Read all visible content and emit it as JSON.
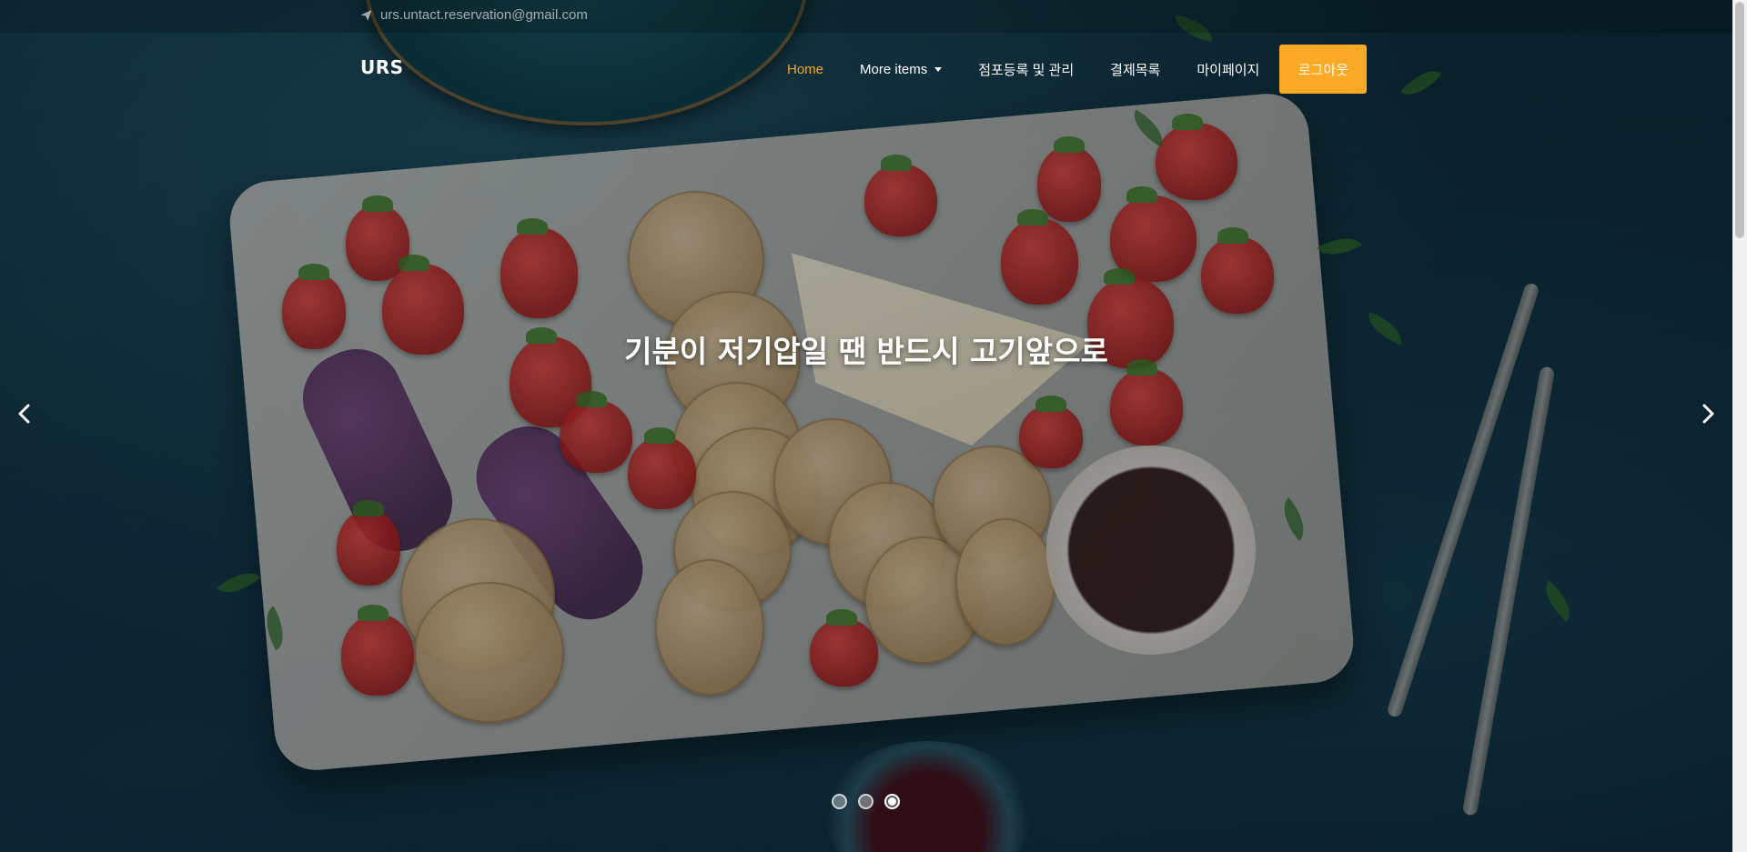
{
  "topbar": {
    "email": "urs.untact.reservation@gmail.com",
    "email_icon": "paper-plane-icon"
  },
  "navbar": {
    "brand": "URS",
    "items": [
      {
        "label": "Home",
        "active": true
      },
      {
        "label": "More items",
        "dropdown": true
      },
      {
        "label": "점포등록 및 관리"
      },
      {
        "label": "결제목록"
      },
      {
        "label": "마이페이지"
      }
    ],
    "logout_label": "로그아웃"
  },
  "hero": {
    "caption": "기분이 저기압일 땐 반드시 고기앞으로",
    "prev_icon": "chevron-left-icon",
    "next_icon": "chevron-right-icon",
    "slides": 3,
    "active_slide": 3
  },
  "colors": {
    "accent": "#fca925",
    "active_nav": "#f7a823",
    "text": "#ffffff"
  }
}
